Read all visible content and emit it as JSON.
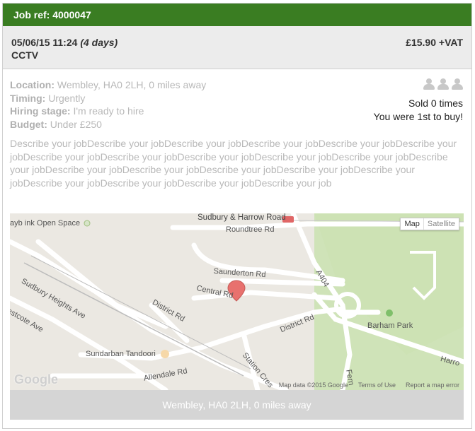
{
  "job": {
    "ref_label": "Job ref: 4000047",
    "date": "05/06/15 11:24",
    "duration": "(4 days)",
    "category": "CCTV",
    "price": "£15.90 +VAT"
  },
  "details": {
    "location_label": "Location:",
    "location_value": "Wembley, HA0 2LH, 0 miles away",
    "timing_label": "Timing:",
    "timing_value": "Urgently",
    "hiring_label": "Hiring stage:",
    "hiring_value": "I'm ready to hire",
    "budget_label": "Budget:",
    "budget_value": "Under £250"
  },
  "buyers": {
    "sold": "Sold 0 times",
    "first": "You were 1st to buy!"
  },
  "description": "Describe your jobDescribe your jobDescribe your jobDescribe your jobDescribe your jobDescribe your jobDescribe your jobDescribe your jobDescribe your jobDescribe your jobDescribe your jobDescribe your jobDescribe your jobDescribe your jobDescribe your jobDescribe your jobDescribe your jobDescribe your jobDescribe your jobDescribe your jobDescribe your job",
  "map": {
    "toggle_map": "Map",
    "toggle_satellite": "Satellite",
    "labels": {
      "open_space": "ayb ink Open Space",
      "station": "Sudbury & Harrow Road",
      "roundtree": "Roundtree Rd",
      "saunderton": "Saunderton Rd",
      "central": "Central Rd",
      "sudbury_heights": "Sudbury Heights Ave",
      "district1": "District Rd",
      "district2": "District Rd",
      "estcote": "estcote Ave",
      "a404": "A404",
      "barham": "Barham Park",
      "tandoori": "Sundarban Tandoori",
      "allendale": "Allendale Rd",
      "station_cres": "Station Cres",
      "fern": "Fern",
      "harro": "Harro"
    },
    "google": "Google",
    "footer_data": "Map data ©2015 Google",
    "footer_terms": "Terms of Use",
    "footer_report": "Report a map error"
  },
  "location_bar": "Wembley, HA0 2LH, 0 miles away",
  "colors": {
    "header_green": "#3a7d22",
    "location_bar": "#d5d5d5",
    "marker": "#e8716e"
  }
}
